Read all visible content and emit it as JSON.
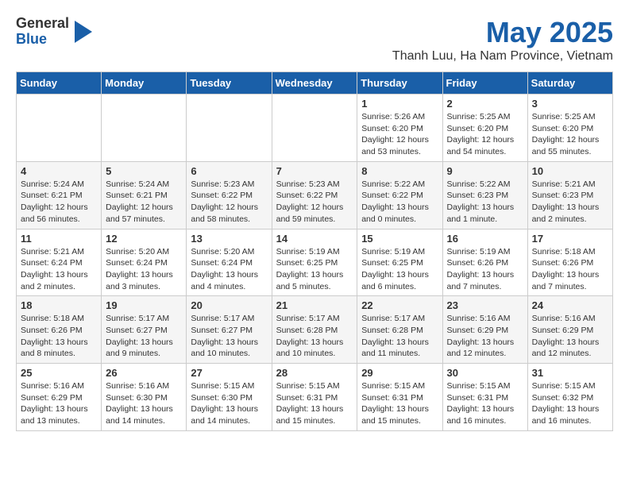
{
  "header": {
    "logo": {
      "general": "General",
      "blue": "Blue"
    },
    "title": "May 2025",
    "subtitle": "Thanh Luu, Ha Nam Province, Vietnam"
  },
  "days_of_week": [
    "Sunday",
    "Monday",
    "Tuesday",
    "Wednesday",
    "Thursday",
    "Friday",
    "Saturday"
  ],
  "weeks": [
    [
      {
        "day": "",
        "info": ""
      },
      {
        "day": "",
        "info": ""
      },
      {
        "day": "",
        "info": ""
      },
      {
        "day": "",
        "info": ""
      },
      {
        "day": "1",
        "info": "Sunrise: 5:26 AM\nSunset: 6:20 PM\nDaylight: 12 hours\nand 53 minutes."
      },
      {
        "day": "2",
        "info": "Sunrise: 5:25 AM\nSunset: 6:20 PM\nDaylight: 12 hours\nand 54 minutes."
      },
      {
        "day": "3",
        "info": "Sunrise: 5:25 AM\nSunset: 6:20 PM\nDaylight: 12 hours\nand 55 minutes."
      }
    ],
    [
      {
        "day": "4",
        "info": "Sunrise: 5:24 AM\nSunset: 6:21 PM\nDaylight: 12 hours\nand 56 minutes."
      },
      {
        "day": "5",
        "info": "Sunrise: 5:24 AM\nSunset: 6:21 PM\nDaylight: 12 hours\nand 57 minutes."
      },
      {
        "day": "6",
        "info": "Sunrise: 5:23 AM\nSunset: 6:22 PM\nDaylight: 12 hours\nand 58 minutes."
      },
      {
        "day": "7",
        "info": "Sunrise: 5:23 AM\nSunset: 6:22 PM\nDaylight: 12 hours\nand 59 minutes."
      },
      {
        "day": "8",
        "info": "Sunrise: 5:22 AM\nSunset: 6:22 PM\nDaylight: 13 hours\nand 0 minutes."
      },
      {
        "day": "9",
        "info": "Sunrise: 5:22 AM\nSunset: 6:23 PM\nDaylight: 13 hours\nand 1 minute."
      },
      {
        "day": "10",
        "info": "Sunrise: 5:21 AM\nSunset: 6:23 PM\nDaylight: 13 hours\nand 2 minutes."
      }
    ],
    [
      {
        "day": "11",
        "info": "Sunrise: 5:21 AM\nSunset: 6:24 PM\nDaylight: 13 hours\nand 2 minutes."
      },
      {
        "day": "12",
        "info": "Sunrise: 5:20 AM\nSunset: 6:24 PM\nDaylight: 13 hours\nand 3 minutes."
      },
      {
        "day": "13",
        "info": "Sunrise: 5:20 AM\nSunset: 6:24 PM\nDaylight: 13 hours\nand 4 minutes."
      },
      {
        "day": "14",
        "info": "Sunrise: 5:19 AM\nSunset: 6:25 PM\nDaylight: 13 hours\nand 5 minutes."
      },
      {
        "day": "15",
        "info": "Sunrise: 5:19 AM\nSunset: 6:25 PM\nDaylight: 13 hours\nand 6 minutes."
      },
      {
        "day": "16",
        "info": "Sunrise: 5:19 AM\nSunset: 6:26 PM\nDaylight: 13 hours\nand 7 minutes."
      },
      {
        "day": "17",
        "info": "Sunrise: 5:18 AM\nSunset: 6:26 PM\nDaylight: 13 hours\nand 7 minutes."
      }
    ],
    [
      {
        "day": "18",
        "info": "Sunrise: 5:18 AM\nSunset: 6:26 PM\nDaylight: 13 hours\nand 8 minutes."
      },
      {
        "day": "19",
        "info": "Sunrise: 5:17 AM\nSunset: 6:27 PM\nDaylight: 13 hours\nand 9 minutes."
      },
      {
        "day": "20",
        "info": "Sunrise: 5:17 AM\nSunset: 6:27 PM\nDaylight: 13 hours\nand 10 minutes."
      },
      {
        "day": "21",
        "info": "Sunrise: 5:17 AM\nSunset: 6:28 PM\nDaylight: 13 hours\nand 10 minutes."
      },
      {
        "day": "22",
        "info": "Sunrise: 5:17 AM\nSunset: 6:28 PM\nDaylight: 13 hours\nand 11 minutes."
      },
      {
        "day": "23",
        "info": "Sunrise: 5:16 AM\nSunset: 6:29 PM\nDaylight: 13 hours\nand 12 minutes."
      },
      {
        "day": "24",
        "info": "Sunrise: 5:16 AM\nSunset: 6:29 PM\nDaylight: 13 hours\nand 12 minutes."
      }
    ],
    [
      {
        "day": "25",
        "info": "Sunrise: 5:16 AM\nSunset: 6:29 PM\nDaylight: 13 hours\nand 13 minutes."
      },
      {
        "day": "26",
        "info": "Sunrise: 5:16 AM\nSunset: 6:30 PM\nDaylight: 13 hours\nand 14 minutes."
      },
      {
        "day": "27",
        "info": "Sunrise: 5:15 AM\nSunset: 6:30 PM\nDaylight: 13 hours\nand 14 minutes."
      },
      {
        "day": "28",
        "info": "Sunrise: 5:15 AM\nSunset: 6:31 PM\nDaylight: 13 hours\nand 15 minutes."
      },
      {
        "day": "29",
        "info": "Sunrise: 5:15 AM\nSunset: 6:31 PM\nDaylight: 13 hours\nand 15 minutes."
      },
      {
        "day": "30",
        "info": "Sunrise: 5:15 AM\nSunset: 6:31 PM\nDaylight: 13 hours\nand 16 minutes."
      },
      {
        "day": "31",
        "info": "Sunrise: 5:15 AM\nSunset: 6:32 PM\nDaylight: 13 hours\nand 16 minutes."
      }
    ]
  ]
}
